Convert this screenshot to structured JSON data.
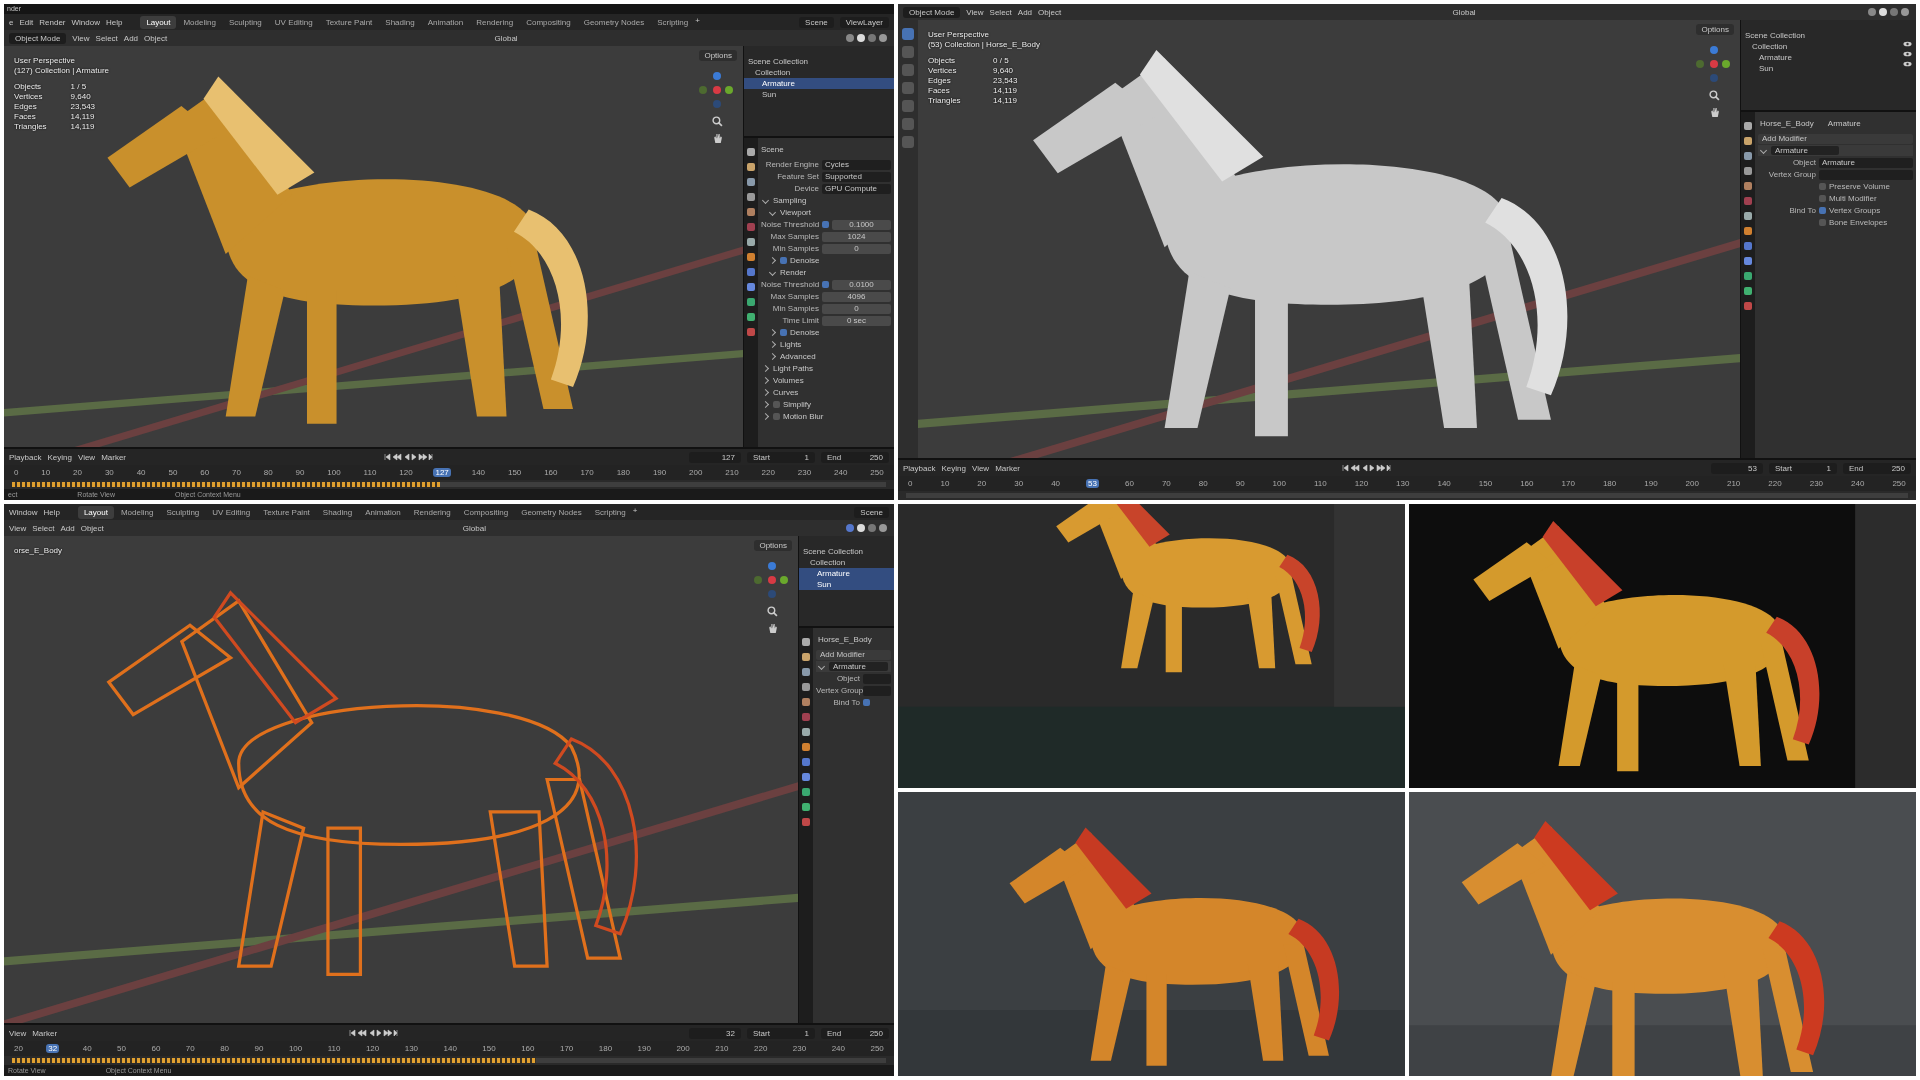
{
  "panels": [
    {
      "kind": "blender",
      "titlebar": "nder",
      "menubar": {
        "items": [
          "e",
          "Edit",
          "Render",
          "Window",
          "Help"
        ],
        "workspaces": [
          {
            "label": "Layout",
            "selected": true
          },
          {
            "label": "Modeling",
            "selected": false
          },
          {
            "label": "Sculpting",
            "selected": false
          },
          {
            "label": "UV Editing",
            "selected": false
          },
          {
            "label": "Texture Paint",
            "selected": false
          },
          {
            "label": "Shading",
            "selected": false
          },
          {
            "label": "Animation",
            "selected": false
          },
          {
            "label": "Rendering",
            "selected": false
          },
          {
            "label": "Compositing",
            "selected": false
          },
          {
            "label": "Geometry Nodes",
            "selected": false
          },
          {
            "label": "Scripting",
            "selected": false
          }
        ],
        "add": "+",
        "scene": "Scene",
        "view_layer": "ViewLayer"
      },
      "header": {
        "mode": "Object Mode",
        "menus": [
          "View",
          "Select",
          "Add",
          "Object"
        ],
        "transform": "Global",
        "options": "Options"
      },
      "overlay": {
        "lines": [
          "User Perspective",
          "(127) Collection | Armature"
        ],
        "stats": [
          {
            "label": "Objects",
            "value": "1 / 5"
          },
          {
            "label": "Vertices",
            "value": "9,640"
          },
          {
            "label": "Edges",
            "value": "23,543"
          },
          {
            "label": "Faces",
            "value": "14,119"
          },
          {
            "label": "Triangles",
            "value": "14,119"
          }
        ]
      },
      "outliner": {
        "items": [
          {
            "label": "Scene Collection",
            "selected": false,
            "children": [
              {
                "label": "Collection",
                "selected": false,
                "children": [
                  {
                    "label": "Armature",
                    "selected": true
                  },
                  {
                    "label": "Sun",
                    "selected": false
                  }
                ]
              }
            ]
          }
        ]
      },
      "properties": {
        "heading": "Scene",
        "rows": [
          {
            "kind": "field",
            "label": "Render Engine",
            "value": "Cycles"
          },
          {
            "kind": "field",
            "label": "Feature Set",
            "value": "Supported"
          },
          {
            "kind": "field",
            "label": "Device",
            "value": "GPU Compute"
          },
          {
            "kind": "section",
            "label": "Sampling",
            "expanded": true
          },
          {
            "kind": "subsection",
            "label": "Viewport",
            "expanded": true
          },
          {
            "kind": "numcheck",
            "label": "Noise Threshold",
            "checked": true,
            "value": "0.1000"
          },
          {
            "kind": "number",
            "label": "Max Samples",
            "value": "1024"
          },
          {
            "kind": "number",
            "label": "Min Samples",
            "value": "0"
          },
          {
            "kind": "subsection",
            "label": "Denoise",
            "expanded": false,
            "checked": true
          },
          {
            "kind": "subsection",
            "label": "Render",
            "expanded": true
          },
          {
            "kind": "numcheck",
            "label": "Noise Threshold",
            "checked": true,
            "value": "0.0100"
          },
          {
            "kind": "number",
            "label": "Max Samples",
            "value": "4096"
          },
          {
            "kind": "number",
            "label": "Min Samples",
            "value": "0"
          },
          {
            "kind": "number",
            "label": "Time Limit",
            "value": "0 sec"
          },
          {
            "kind": "subsection",
            "label": "Denoise",
            "expanded": false,
            "checked": true
          },
          {
            "kind": "subsection",
            "label": "Lights",
            "expanded": false
          },
          {
            "kind": "subsection",
            "label": "Advanced",
            "expanded": false
          },
          {
            "kind": "section",
            "label": "Light Paths",
            "expanded": false
          },
          {
            "kind": "section",
            "label": "Volumes",
            "expanded": false
          },
          {
            "kind": "section",
            "label": "Curves",
            "expanded": false
          },
          {
            "kind": "section",
            "label": "Simplify",
            "expanded": false,
            "checked": false
          },
          {
            "kind": "section",
            "label": "Motion Blur",
            "expanded": false,
            "checked": false
          }
        ]
      },
      "timeline": {
        "menus": [
          "Playback",
          "Keying",
          "View",
          "Marker"
        ],
        "frame": "127",
        "fields": [
          {
            "label": "Start",
            "value": "1"
          },
          {
            "label": "End",
            "value": "250"
          }
        ],
        "ticks": [
          {
            "label": "0",
            "selected": false
          },
          {
            "label": "10",
            "selected": false
          },
          {
            "label": "20",
            "selected": false
          },
          {
            "label": "30",
            "selected": false
          },
          {
            "label": "40",
            "selected": false
          },
          {
            "label": "50",
            "selected": false
          },
          {
            "label": "60",
            "selected": false
          },
          {
            "label": "70",
            "selected": false
          },
          {
            "label": "80",
            "selected": false
          },
          {
            "label": "90",
            "selected": false
          },
          {
            "label": "100",
            "selected": false
          },
          {
            "label": "110",
            "selected": false
          },
          {
            "label": "120",
            "selected": false
          },
          {
            "label": "127",
            "selected": true
          },
          {
            "label": "140",
            "selected": false
          },
          {
            "label": "150",
            "selected": false
          },
          {
            "label": "160",
            "selected": false
          },
          {
            "label": "170",
            "selected": false
          },
          {
            "label": "180",
            "selected": false
          },
          {
            "label": "190",
            "selected": false
          },
          {
            "label": "200",
            "selected": false
          },
          {
            "label": "210",
            "selected": false
          },
          {
            "label": "220",
            "selected": false
          },
          {
            "label": "230",
            "selected": false
          },
          {
            "label": "240",
            "selected": false
          },
          {
            "label": "250",
            "selected": false
          }
        ],
        "keyframes": {
          "level": 0.49
        }
      },
      "status": [
        "ect",
        "Rotate View",
        "Object Context Menu"
      ]
    },
    {
      "kind": "blender",
      "toolbar": true,
      "visibility_icons": true,
      "header": {
        "mode": "Object Mode",
        "menus": [
          "View",
          "Select",
          "Add",
          "Object"
        ],
        "transform": "Global",
        "options": "Options"
      },
      "overlay": {
        "lines": [
          "User Perspective",
          "(53) Collection | Horse_E_Body"
        ],
        "stats": [
          {
            "label": "Objects",
            "value": "0 / 5"
          },
          {
            "label": "Vertices",
            "value": "9,640"
          },
          {
            "label": "Edges",
            "value": "23,543"
          },
          {
            "label": "Faces",
            "value": "14,119"
          },
          {
            "label": "Triangles",
            "value": "14,119"
          }
        ]
      },
      "outliner": {
        "items": [
          {
            "label": "Scene Collection",
            "selected": false,
            "children": [
              {
                "label": "Collection",
                "selected": false,
                "children": [
                  {
                    "label": "Armature",
                    "selected": false
                  },
                  {
                    "label": "Sun",
                    "selected": false
                  }
                ]
              }
            ]
          }
        ]
      },
      "properties": {
        "breadcrumb": [
          "Horse_E_Body",
          "Armature"
        ],
        "rows": [
          {
            "kind": "button",
            "label": "Add Modifier"
          },
          {
            "kind": "modifier",
            "label": "Armature",
            "expanded": true
          },
          {
            "kind": "objfield",
            "label": "Object",
            "value": "Armature"
          },
          {
            "kind": "objfield",
            "label": "Vertex Group"
          },
          {
            "kind": "check",
            "label": "Preserve Volume",
            "checked": false
          },
          {
            "kind": "check",
            "label": "Multi Modifier",
            "checked": false
          },
          {
            "kind": "check",
            "prefix": "Bind To",
            "label": "Vertex Groups",
            "checked": true
          },
          {
            "kind": "check",
            "label": "Bone Envelopes",
            "checked": false
          }
        ]
      },
      "timeline": {
        "menus": [
          "Playback",
          "Keying",
          "View",
          "Marker"
        ],
        "frame": "53",
        "fields": [
          {
            "label": "Start",
            "value": "1"
          },
          {
            "label": "End",
            "value": "250"
          }
        ],
        "ticks": [
          {
            "label": "0",
            "selected": false
          },
          {
            "label": "10",
            "selected": false
          },
          {
            "label": "20",
            "selected": false
          },
          {
            "label": "30",
            "selected": false
          },
          {
            "label": "40",
            "selected": false
          },
          {
            "label": "53",
            "selected": true
          },
          {
            "label": "60",
            "selected": false
          },
          {
            "label": "70",
            "selected": false
          },
          {
            "label": "80",
            "selected": false
          },
          {
            "label": "90",
            "selected": false
          },
          {
            "label": "100",
            "selected": false
          },
          {
            "label": "110",
            "selected": false
          },
          {
            "label": "120",
            "selected": false
          },
          {
            "label": "130",
            "selected": false
          },
          {
            "label": "140",
            "selected": false
          },
          {
            "label": "150",
            "selected": false
          },
          {
            "label": "160",
            "selected": false
          },
          {
            "label": "170",
            "selected": false
          },
          {
            "label": "180",
            "selected": false
          },
          {
            "label": "190",
            "selected": false
          },
          {
            "label": "200",
            "selected": false
          },
          {
            "label": "210",
            "selected": false
          },
          {
            "label": "220",
            "selected": false
          },
          {
            "label": "230",
            "selected": false
          },
          {
            "label": "240",
            "selected": false
          },
          {
            "label": "250",
            "selected": false
          }
        ]
      }
    },
    {
      "kind": "blender",
      "menubar": {
        "items": [
          "Window",
          "Help"
        ],
        "workspaces": [
          {
            "label": "Layout",
            "selected": true
          },
          {
            "label": "Modeling",
            "selected": false
          },
          {
            "label": "Sculpting",
            "selected": false
          },
          {
            "label": "UV Editing",
            "selected": false
          },
          {
            "label": "Texture Paint",
            "selected": false
          },
          {
            "label": "Shading",
            "selected": false
          },
          {
            "label": "Animation",
            "selected": false
          },
          {
            "label": "Rendering",
            "selected": false
          },
          {
            "label": "Compositing",
            "selected": false
          },
          {
            "label": "Geometry Nodes",
            "selected": false
          },
          {
            "label": "Scripting",
            "selected": false
          }
        ],
        "add": "+",
        "scene": "Scene"
      },
      "header": {
        "menus": [
          "View",
          "Select",
          "Add",
          "Object"
        ],
        "transform": "Global",
        "options": "Options"
      },
      "overlay": {
        "lines": [
          "orse_E_Body"
        ]
      },
      "outliner": {
        "items": [
          {
            "label": "Scene Collection",
            "selected": false,
            "children": [
              {
                "label": "Collection",
                "selected": false,
                "children": [
                  {
                    "label": "Armature",
                    "selected": true
                  },
                  {
                    "label": "Sun",
                    "selected": true
                  }
                ]
              }
            ]
          }
        ]
      },
      "properties": {
        "breadcrumb": [
          "Horse_E_Body"
        ],
        "rows": [
          {
            "kind": "button",
            "label": "Add Modifier"
          },
          {
            "kind": "modifier",
            "label": "Armature",
            "expanded": true
          },
          {
            "kind": "objfield",
            "label": "Object"
          },
          {
            "kind": "objfield",
            "label": "Vertex Group"
          },
          {
            "kind": "check",
            "prefix": "Bind To",
            "checked": true
          }
        ]
      },
      "timeline": {
        "menus": [
          "View",
          "Marker"
        ],
        "frame": "32",
        "fields": [
          {
            "label": "Start",
            "value": "1"
          },
          {
            "label": "End",
            "value": "250"
          }
        ],
        "ticks": [
          {
            "label": "20",
            "selected": false
          },
          {
            "label": "32",
            "selected": true
          },
          {
            "label": "40",
            "selected": false
          },
          {
            "label": "50",
            "selected": false
          },
          {
            "label": "60",
            "selected": false
          },
          {
            "label": "70",
            "selected": false
          },
          {
            "label": "80",
            "selected": false
          },
          {
            "label": "90",
            "selected": false
          },
          {
            "label": "100",
            "selected": false
          },
          {
            "label": "110",
            "selected": false
          },
          {
            "label": "120",
            "selected": false
          },
          {
            "label": "130",
            "selected": false
          },
          {
            "label": "140",
            "selected": false
          },
          {
            "label": "150",
            "selected": false
          },
          {
            "label": "160",
            "selected": false
          },
          {
            "label": "170",
            "selected": false
          },
          {
            "label": "180",
            "selected": false
          },
          {
            "label": "190",
            "selected": false
          },
          {
            "label": "200",
            "selected": false
          },
          {
            "label": "210",
            "selected": false
          },
          {
            "label": "220",
            "selected": false
          },
          {
            "label": "230",
            "selected": false
          },
          {
            "label": "240",
            "selected": false
          },
          {
            "label": "250",
            "selected": false
          }
        ],
        "keyframes": {
          "level": 0.6
        }
      },
      "status": [
        "Rotate View",
        "Object Context Menu"
      ]
    },
    {
      "kind": "picture"
    },
    {
      "kind": "picture"
    },
    {
      "kind": "picture"
    },
    {
      "kind": "picture"
    }
  ]
}
